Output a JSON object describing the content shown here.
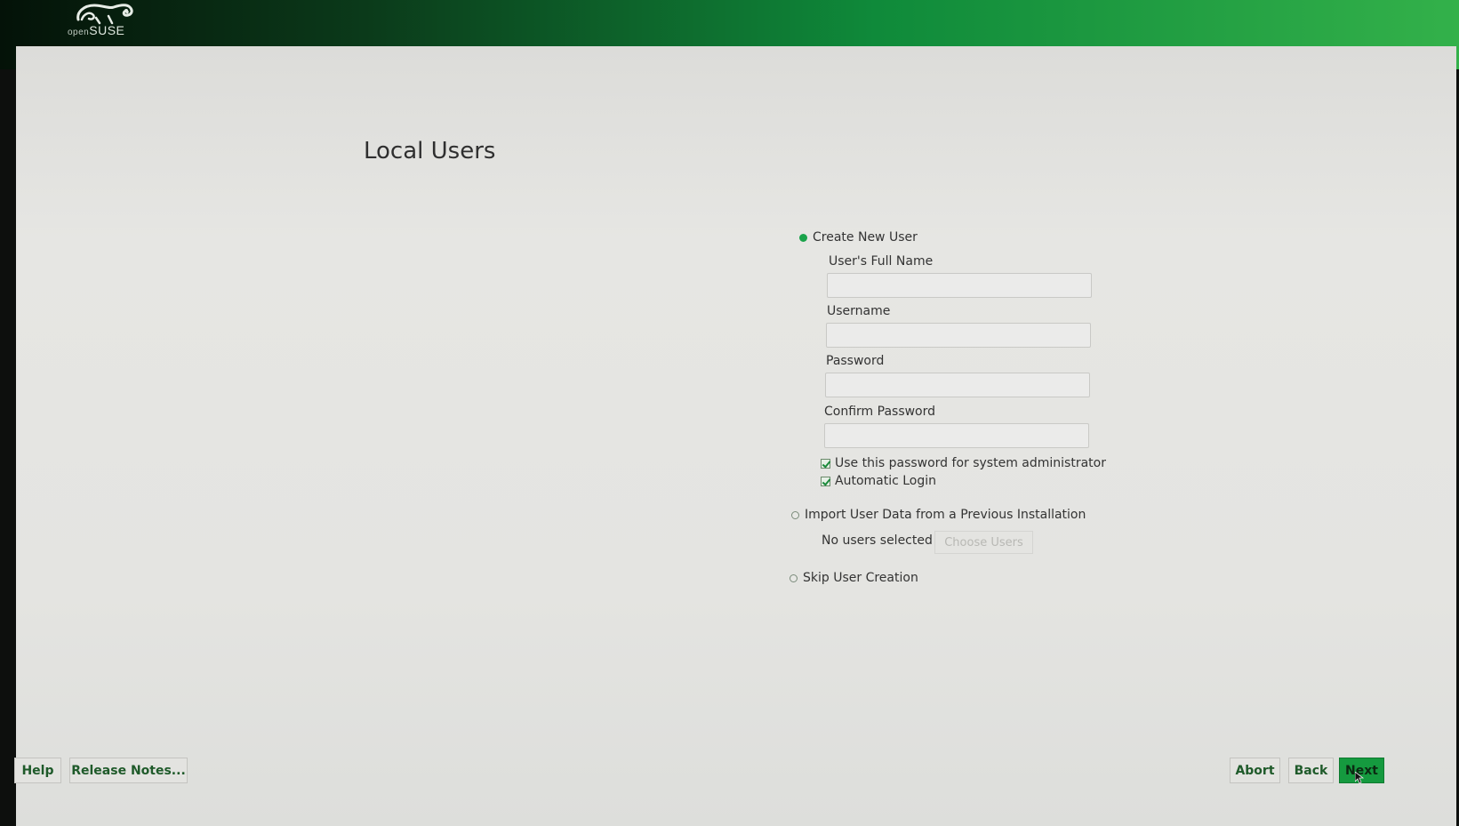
{
  "brand": {
    "logo_prefix": "open",
    "logo_name": "SUSE"
  },
  "page": {
    "title": "Local Users"
  },
  "create_user": {
    "radio_label": "Create New User",
    "selected": true,
    "full_name_label": "User's Full Name",
    "full_name_value": "",
    "username_label": "Username",
    "username_value": "",
    "password_label": "Password",
    "password_value": "",
    "confirm_label": "Confirm Password",
    "confirm_value": "",
    "use_for_admin_label": "Use this password for system administrator",
    "use_for_admin_checked": true,
    "auto_login_label": "Automatic Login",
    "auto_login_checked": true
  },
  "import_users": {
    "radio_label": "Import User Data from a Previous Installation",
    "selected": false,
    "status_text": "No users selected",
    "choose_label": "Choose Users"
  },
  "skip_users": {
    "radio_label": "Skip User Creation",
    "selected": false
  },
  "footer": {
    "help_label": "Help",
    "release_notes_label": "Release Notes...",
    "abort_label": "Abort",
    "back_label": "Back",
    "next_label": "Next"
  },
  "colors": {
    "accent": "#159a3f",
    "header_start": "#041208",
    "header_end": "#33b14a"
  },
  "icons": {
    "logo": "opensuse-chameleon-icon",
    "cursor": "mouse-pointer-icon"
  }
}
